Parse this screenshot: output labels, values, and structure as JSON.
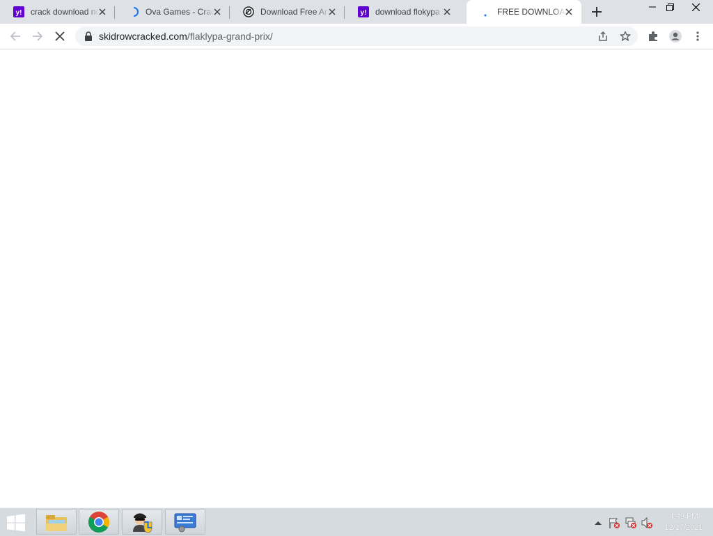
{
  "browser": {
    "tabs": [
      {
        "title": "crack download no",
        "favicon": "yahoo-icon"
      },
      {
        "title": "Ova Games - Crack",
        "favicon": "loading-spinner-icon"
      },
      {
        "title": "Download Free An",
        "favicon": "site-logo-icon"
      },
      {
        "title": "download flokypa",
        "favicon": "yahoo-icon"
      },
      {
        "title": "FREE DOWNLOAD",
        "favicon": "loading-dot-icon",
        "active": true
      }
    ],
    "address": {
      "host": "skidrowcracked.com",
      "path": "/flaklypa-grand-prix/"
    }
  },
  "taskbar": {
    "apps": [
      "file-explorer-icon",
      "chrome-icon",
      "security-agent-icon",
      "control-panel-icon"
    ],
    "clock": {
      "time": "4:49 PM",
      "date": "12/17/2021"
    }
  },
  "colors": {
    "yahoo": "#6001d2",
    "chrome_blue": "#1a73e8",
    "tabstrip": "#dee1e6",
    "taskbar": "#d6dbe0"
  }
}
